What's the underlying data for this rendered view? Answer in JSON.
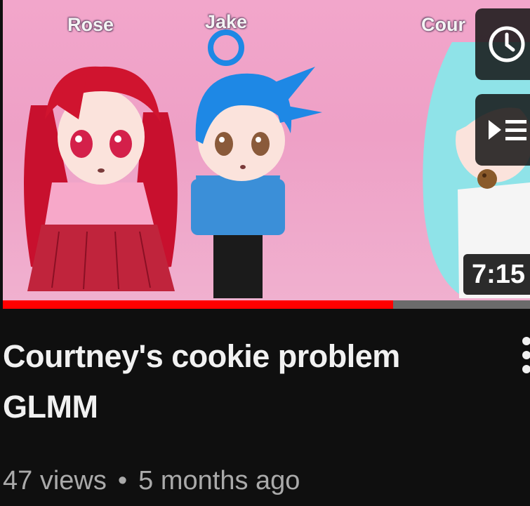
{
  "thumbnail": {
    "characters": [
      {
        "name": "Rose",
        "hair_color": "#c8102e",
        "outfit_color": "#f7a8c9"
      },
      {
        "name": "Jake",
        "hair_color": "#1e88e5",
        "outfit_color": "#3b8fd8"
      },
      {
        "name": "Cour",
        "hair_color": "#8fe3e8",
        "outfit_color": "#f5f5f5"
      }
    ],
    "background_color": "#f0a6ca",
    "watched_fraction": 0.74
  },
  "overlay_buttons": {
    "watch_later_icon": "clock-icon",
    "add_to_queue_icon": "queue-icon"
  },
  "duration": "7:15",
  "video": {
    "title": "Courtney's cookie problem GLMM",
    "views": "47 views",
    "separator": "•",
    "age": "5 months ago"
  },
  "menu_icon": "more-vert-icon",
  "colors": {
    "background": "#0f0f0f",
    "title": "#f1f1f1",
    "meta": "#aaaaaa",
    "progress": "#ff0000"
  }
}
